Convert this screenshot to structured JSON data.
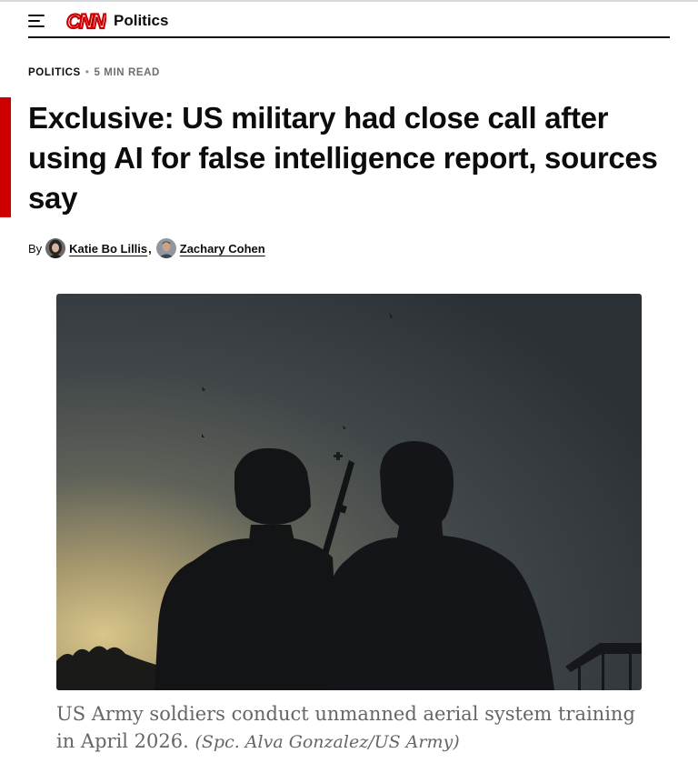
{
  "header": {
    "menu_icon": "hamburger-menu-icon",
    "logo_text": "CNN",
    "logo_color": "#cc0000",
    "section": "Politics"
  },
  "article": {
    "section_label": "POLITICS",
    "separator": "•",
    "read_time": "5 MIN READ",
    "headline": "Exclusive: US military had close call after using AI for false intelligence report, sources say",
    "accent_color": "#cc0000",
    "byline_prefix": "By",
    "authors": [
      {
        "name": "Katie Bo Lillis"
      },
      {
        "name": "Zachary Cohen"
      }
    ],
    "byline_comma": ","
  },
  "image": {
    "caption": "US Army soldiers conduct unmanned aerial system training in April 2026.",
    "credit": "(Spc. Alva Gonzalez/US Army)"
  }
}
